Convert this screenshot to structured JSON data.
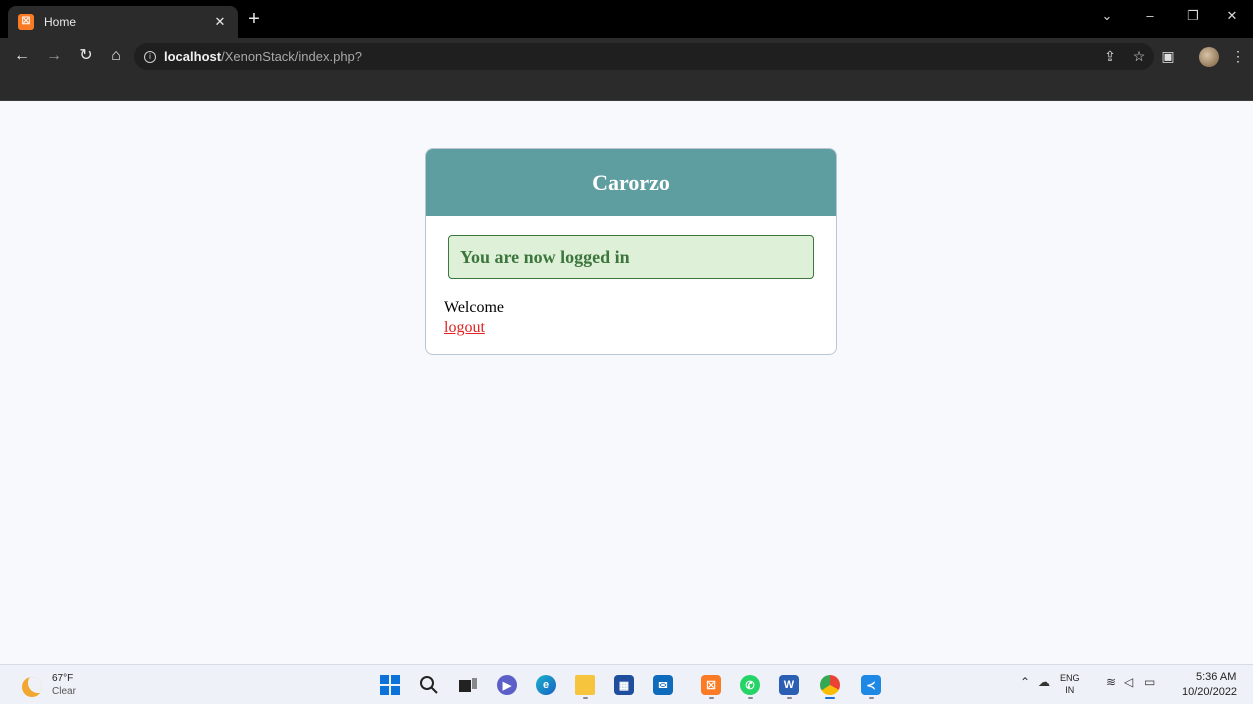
{
  "browser": {
    "tab": {
      "title": "Home",
      "favicon_label": "☒"
    },
    "address": {
      "host": "localhost",
      "path": "/XenonStack/index.php?"
    }
  },
  "page": {
    "card_title": "Carorzo",
    "alert_message": "You are now logged in",
    "welcome_text": "Welcome",
    "logout_label": "logout"
  },
  "taskbar": {
    "weather": {
      "temp": "67°F",
      "condition": "Clear"
    },
    "tray": {
      "lang_top": "ENG",
      "lang_bottom": "IN"
    },
    "clock": {
      "time": "5:36 AM",
      "date": "10/20/2022"
    },
    "apps": [
      "start",
      "search",
      "task-view",
      "teams-chat",
      "edge",
      "file-explorer",
      "store",
      "mail",
      "xampp",
      "whatsapp",
      "word",
      "chrome",
      "vscode"
    ]
  },
  "colors": {
    "card_header": "#5f9ea0",
    "alert_bg": "#dff0d8",
    "alert_text": "#3c763d",
    "link": "#e02222"
  }
}
